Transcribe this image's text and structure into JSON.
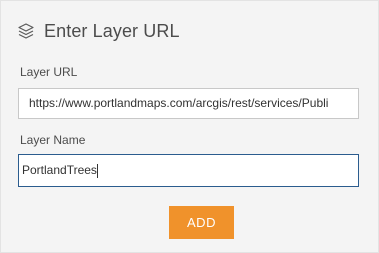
{
  "header": {
    "icon": "layers-icon",
    "title": "Enter Layer URL"
  },
  "layer_url": {
    "label": "Layer URL",
    "value": "https://www.portlandmaps.com/arcgis/rest/services/Publi"
  },
  "layer_name": {
    "label": "Layer Name",
    "value": "PortlandTrees"
  },
  "add_button": {
    "label": "ADD"
  },
  "colors": {
    "panel_bg": "#f4f4f4",
    "accent_button": "#f0922b",
    "focus_border": "#2b5c8e",
    "text": "#4c4c4c"
  }
}
